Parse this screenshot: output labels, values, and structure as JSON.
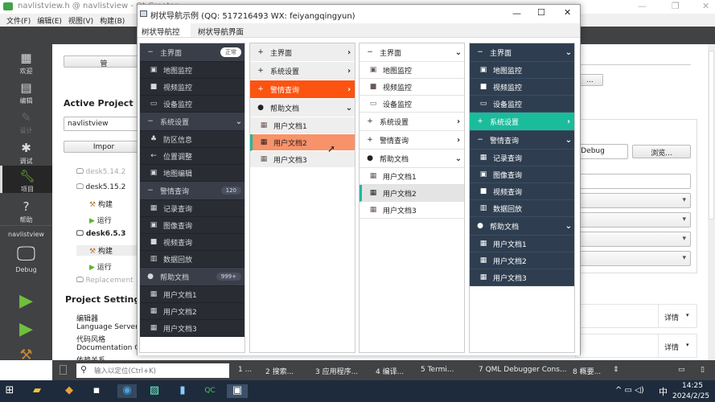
{
  "qt": {
    "title": "navlistview.h @ navlistview - Qt Creator",
    "menu": [
      "文件(F)",
      "编辑(E)",
      "视图(V)",
      "构建(B)"
    ],
    "modes": [
      {
        "icon": "grid-icon",
        "label": "欢迎"
      },
      {
        "icon": "edit-icon",
        "label": "编辑"
      },
      {
        "icon": "pencil-icon",
        "label": "设计"
      },
      {
        "icon": "bug-icon",
        "label": "调试"
      },
      {
        "icon": "wrench-icon",
        "label": "项目"
      },
      {
        "icon": "help-icon",
        "label": "帮助"
      }
    ],
    "target": {
      "project": "navlistview",
      "config": "Debug"
    },
    "manage_btn": "管",
    "active_project_heading": "Active Project",
    "project_combo": "navlistview",
    "import_btn": "Impor",
    "kits": [
      {
        "label": "desk5.14.2",
        "level": 0
      },
      {
        "label": "desk5.15.2",
        "level": 0
      },
      {
        "label": "构建",
        "level": 1
      },
      {
        "label": "运行",
        "level": 1
      },
      {
        "label": "desk6.5.3",
        "level": 0
      },
      {
        "label": "构建",
        "level": 1
      },
      {
        "label": "运行",
        "level": 1
      },
      {
        "label": "Replacement",
        "level": 0
      }
    ],
    "project_settings_heading": "Project Settings",
    "settings": [
      "编辑器",
      "Language Server",
      "代码风格",
      "Documentation C",
      "依赖关系"
    ],
    "right": {
      "ellipsis_btn": "...",
      "build_dir": "-Debug",
      "browse_btn": "浏览...",
      "details": [
        "详情",
        "详情"
      ]
    },
    "locator_placeholder": "输入以定位(Ctrl+K)",
    "output_tabs": [
      "1 ...",
      "2 搜索...",
      "3 应用程序...",
      "4 编译...",
      "5 Termi...",
      "7 QML Debugger Cons...",
      "8 概要..."
    ]
  },
  "dialog": {
    "title": "树状导航示例 (QQ: 517216493 WX: feiyangqingyun)",
    "tabs": [
      "树状导航控件",
      "树状导航界面"
    ]
  },
  "panels": [
    {
      "theme": {
        "bg": "#292c33",
        "hdr": "#393e48",
        "fg": "#d5d7dc",
        "line": "#20232a",
        "sel": "",
        "selfg": ""
      },
      "rows": [
        {
          "t": "h",
          "icon": "−",
          "label": "主界面",
          "badge": "正常",
          "badgeStyle": "light"
        },
        {
          "t": "i",
          "icon": "▣",
          "label": "地图监控"
        },
        {
          "t": "i",
          "icon": "■",
          "label": "视频监控"
        },
        {
          "t": "i",
          "icon": "▭",
          "label": "设备监控"
        },
        {
          "t": "h",
          "icon": "−",
          "label": "系统设置",
          "arrow": "⌄"
        },
        {
          "t": "i",
          "icon": "♣",
          "label": "防区信息"
        },
        {
          "t": "i",
          "icon": "←",
          "label": "位置调整"
        },
        {
          "t": "i",
          "icon": "▣",
          "label": "地图编辑"
        },
        {
          "t": "h",
          "icon": "−",
          "label": "警情查询",
          "badge": "120",
          "badgeStyle": "dark"
        },
        {
          "t": "i",
          "icon": "▦",
          "label": "记录查询"
        },
        {
          "t": "i",
          "icon": "▣",
          "label": "图像查询"
        },
        {
          "t": "i",
          "icon": "■",
          "label": "视频查询"
        },
        {
          "t": "i",
          "icon": "▥",
          "label": "数据回放"
        },
        {
          "t": "h",
          "icon": "●",
          "label": "帮助文档",
          "badge": "999+",
          "badgeStyle": "dark"
        },
        {
          "t": "i",
          "icon": "▦",
          "label": "用户文档1"
        },
        {
          "t": "i",
          "icon": "▦",
          "label": "用户文档2"
        },
        {
          "t": "i",
          "icon": "▦",
          "label": "用户文档3"
        }
      ]
    },
    {
      "theme": {
        "bg": "#eeeeee",
        "hdr": "#eeeeee",
        "fg": "#222222",
        "line": "#ffffff"
      },
      "rows": [
        {
          "t": "h",
          "icon": "+",
          "label": "主界面",
          "arrow": "›"
        },
        {
          "t": "h",
          "icon": "+",
          "label": "系统设置",
          "arrow": "›"
        },
        {
          "t": "h",
          "icon": "+",
          "label": "警情查询",
          "arrow": "›",
          "state": "active",
          "color": "#fd5310"
        },
        {
          "t": "h",
          "icon": "●",
          "label": "帮助文档",
          "arrow": "⌄"
        },
        {
          "t": "i",
          "icon": "▦",
          "label": "用户文档1"
        },
        {
          "t": "i",
          "icon": "▦",
          "label": "用户文档2",
          "state": "selected",
          "color": "#f8926a",
          "mark": "#1abc9c"
        },
        {
          "t": "i",
          "icon": "▦",
          "label": "用户文档3"
        }
      ]
    },
    {
      "theme": {
        "bg": "#ffffff",
        "hdr": "#ffffff",
        "fg": "#222222",
        "line": "#e2e2e2"
      },
      "rows": [
        {
          "t": "h",
          "icon": "−",
          "label": "主界面",
          "arrow": "⌄"
        },
        {
          "t": "i",
          "icon": "▣",
          "label": "地图监控"
        },
        {
          "t": "i",
          "icon": "■",
          "label": "视频监控"
        },
        {
          "t": "i",
          "icon": "▭",
          "label": "设备监控"
        },
        {
          "t": "h",
          "icon": "+",
          "label": "系统设置",
          "arrow": "›"
        },
        {
          "t": "h",
          "icon": "+",
          "label": "警情查询",
          "arrow": "›"
        },
        {
          "t": "h",
          "icon": "●",
          "label": "帮助文档",
          "arrow": "⌄"
        },
        {
          "t": "i",
          "icon": "▦",
          "label": "用户文档1"
        },
        {
          "t": "i",
          "icon": "▦",
          "label": "用户文档2",
          "state": "selected",
          "color": "#e4e4e4",
          "mark": "#1abc9c"
        },
        {
          "t": "i",
          "icon": "▦",
          "label": "用户文档3"
        }
      ]
    },
    {
      "theme": {
        "bg": "#2e3e50",
        "hdr": "#2e3e50",
        "fg": "#ffffff",
        "line": "#3b4d61"
      },
      "rows": [
        {
          "t": "h",
          "icon": "−",
          "label": "主界面",
          "arrow": "⌄"
        },
        {
          "t": "i",
          "icon": "▣",
          "label": "地图监控"
        },
        {
          "t": "i",
          "icon": "■",
          "label": "视频监控"
        },
        {
          "t": "i",
          "icon": "▭",
          "label": "设备监控"
        },
        {
          "t": "h",
          "icon": "+",
          "label": "系统设置",
          "arrow": "›",
          "state": "active",
          "color": "#1abc9c"
        },
        {
          "t": "h",
          "icon": "−",
          "label": "警情查询",
          "arrow": "⌄"
        },
        {
          "t": "i",
          "icon": "▦",
          "label": "记录查询"
        },
        {
          "t": "i",
          "icon": "▣",
          "label": "图像查询"
        },
        {
          "t": "i",
          "icon": "■",
          "label": "视频查询"
        },
        {
          "t": "i",
          "icon": "▥",
          "label": "数据回放"
        },
        {
          "t": "h",
          "icon": "●",
          "label": "帮助文档",
          "arrow": "⌄"
        },
        {
          "t": "i",
          "icon": "▦",
          "label": "用户文档1"
        },
        {
          "t": "i",
          "icon": "▦",
          "label": "用户文档2"
        },
        {
          "t": "i",
          "icon": "▦",
          "label": "用户文档3"
        }
      ]
    }
  ],
  "tray": {
    "ime": "中",
    "time": "14:25",
    "date": "2024/2/25"
  }
}
